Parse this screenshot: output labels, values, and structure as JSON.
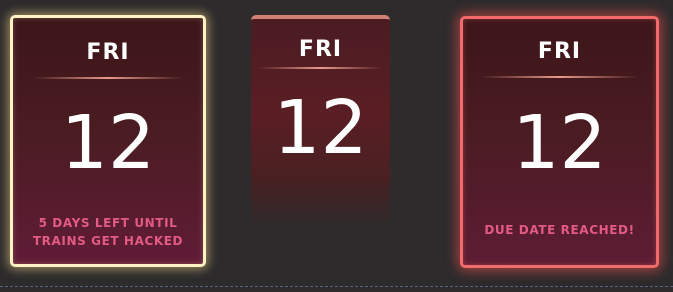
{
  "cards": [
    {
      "day": "FRI",
      "date": "12",
      "note": "5 DAYS LEFT UNTIL\nTRAINS GET HACKED",
      "border_color": "#fff2c4"
    },
    {
      "day": "FRI",
      "date": "12",
      "note": "",
      "border_color": "#d08074"
    },
    {
      "day": "FRI",
      "date": "12",
      "note": "DUE DATE REACHED!",
      "border_color": "#f26a6a"
    }
  ],
  "colors": {
    "background": "#2d2b2c",
    "note_text": "#e35a83",
    "card_fill": "#4a1c22"
  }
}
